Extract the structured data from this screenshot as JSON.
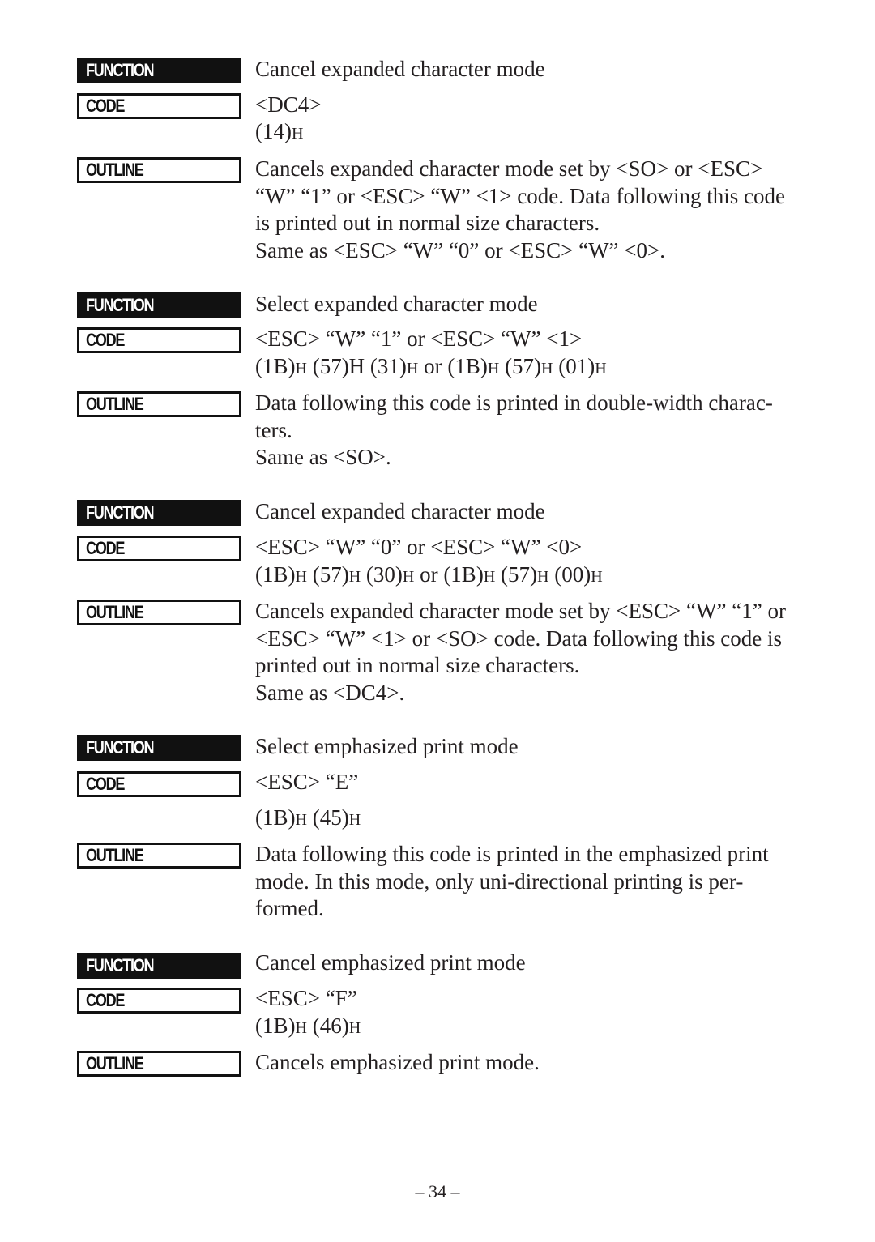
{
  "labels": {
    "function": "FUNCTION",
    "code": "CODE",
    "outline": "OUTLINE"
  },
  "entries": [
    {
      "function": "Cancel expanded character mode",
      "code": "<DC4>",
      "hex": [
        [
          "(14)",
          "H"
        ]
      ],
      "outline": [
        "Cancels expanded character mode set by <SO> or <ESC>",
        "“W” “1” or <ESC> “W” <1> code. Data following this code",
        "is printed out in normal size characters.",
        "Same as <ESC> “W” “0” or <ESC> “W” <0>."
      ]
    },
    {
      "function": "Select expanded character mode",
      "code": "<ESC> “W” “1” or <ESC> “W” <1>",
      "hex": [
        [
          "(1B)",
          "H"
        ],
        [
          " (57)H (31)",
          "H"
        ],
        [
          " or (1B)",
          "H"
        ],
        [
          " (57)",
          "H"
        ],
        [
          " (01)",
          "H"
        ]
      ],
      "outline": [
        "Data following this code is printed in double-width charac-",
        "ters.",
        "Same as <SO>."
      ]
    },
    {
      "function": "Cancel expanded character mode",
      "code": "<ESC> “W” “0” or <ESC> “W” <0>",
      "hex": [
        [
          "(1B)",
          "H"
        ],
        [
          " (57)",
          "H"
        ],
        [
          " (30)",
          "H"
        ],
        [
          " or (1B)",
          "H"
        ],
        [
          " (57)",
          "H"
        ],
        [
          " (00)",
          "H"
        ]
      ],
      "outline": [
        "Cancels expanded character mode set by <ESC> “W” “1” or",
        "<ESC> “W” <1> or <SO> code. Data following this code is",
        "printed out in normal size characters.",
        "Same as <DC4>."
      ]
    },
    {
      "function": "Select emphasized print mode",
      "code": "<ESC> “E”",
      "hex": [
        [
          "(1B)",
          "H"
        ],
        [
          " (45)",
          "H"
        ]
      ],
      "outline": [
        "Data following this code is printed in the emphasized print",
        "mode. In this mode, only uni-directional printing is per-",
        "formed."
      ]
    },
    {
      "function": "Cancel emphasized print mode",
      "code": "<ESC> “F”",
      "hex": [
        [
          "(1B)",
          "H"
        ],
        [
          " (46)",
          "H"
        ]
      ],
      "outline": [
        "Cancels emphasized print mode."
      ]
    }
  ],
  "page_number": "– 34 –"
}
